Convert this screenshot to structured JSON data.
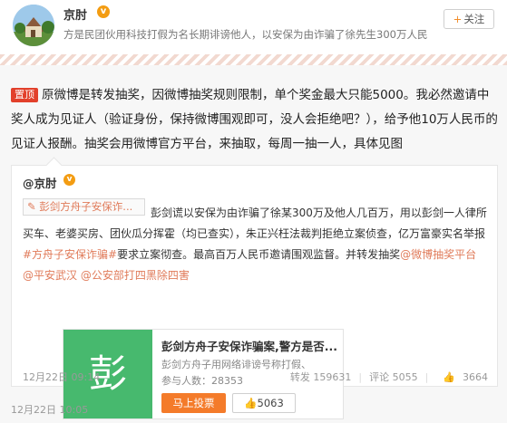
{
  "header": {
    "username": "京肘",
    "verified_badge": "v",
    "bio": "方是民团伙用科技打假为名长期诽谤他人，以安保为由诈骗了徐先生300万人民",
    "follow_label": "关注",
    "follow_plus": "+"
  },
  "post": {
    "pin_label": "置顶",
    "text": "原微博是转发抽奖，因微博抽奖规则限制，单个奖金最大只能5000。我必然邀请中奖人成为见证人（验证身份，保持微博围观即可，没人会拒绝吧？），给予他10万人民币的见证人报酬。抽奖会用微博官方平台，来抽取，每周一抽一人，具体见图",
    "time": "12月22日 10:05"
  },
  "repost": {
    "username": "@京肘",
    "verified_badge": "v",
    "topic_link": "彭剑方舟子安保诈...",
    "text_part1": "彭剑谎以安保为由诈骗了徐某300万及他人几百万，用以彭剑一人律所买车、老婆买房、团伙瓜分挥霍（均已查实），朱正兴枉法裁判拒绝立案侦查，亿万富豪实名举报",
    "hashtag": "#方舟子安保诈骗#",
    "text_part2": "要求立案彻查。最高百万人民币邀请围观监督。并转发抽奖",
    "mention1": "@微博抽奖平台",
    "mention2": "@平安武汉",
    "mention3": "@公安部打四黑除四害",
    "time": "12月22日 09:14",
    "reposts": "转发 159631",
    "comments": "评论 5055",
    "likes": "3664"
  },
  "vote_card": {
    "thumb_char": "彭",
    "title": "彭剑方舟子安保诈骗案,警方是否...",
    "desc": "彭剑方舟子用网络诽谤号称打假、",
    "count": "参与人数：28353",
    "vote_button": "马上投票",
    "like_count": "5063"
  },
  "colors": {
    "accent_orange": "#f47b2a",
    "pin_red": "#e2402b",
    "link_color": "#e07b5a",
    "vote_green": "#47b96e"
  }
}
